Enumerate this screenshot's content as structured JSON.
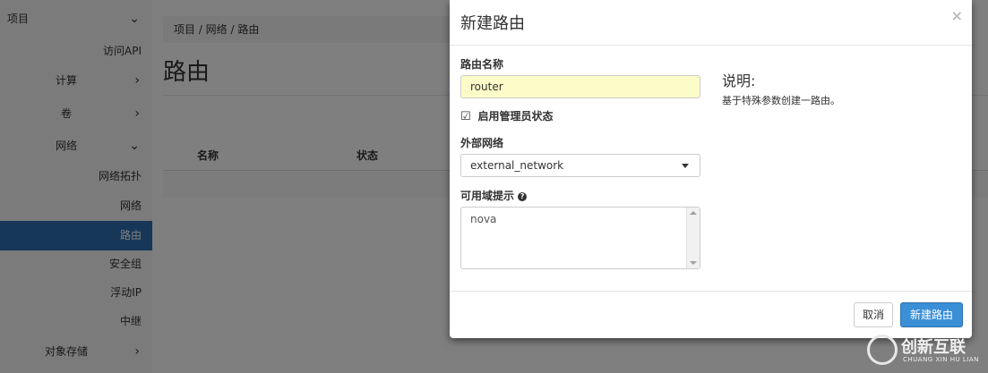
{
  "sidebar": {
    "items": [
      {
        "label": "项目",
        "chevron": "chevron-down"
      },
      {
        "label": "访问API"
      },
      {
        "label": "计算",
        "chevron": "chevron-right"
      },
      {
        "label": "卷",
        "chevron": "chevron-right"
      },
      {
        "label": "网络",
        "chevron": "chevron-down"
      },
      {
        "label": "网络拓扑"
      },
      {
        "label": "网络"
      },
      {
        "label": "路由",
        "active": true
      },
      {
        "label": "安全组"
      },
      {
        "label": "浮动IP"
      },
      {
        "label": "中继"
      },
      {
        "label": "对象存储",
        "chevron": "chevron-right"
      }
    ]
  },
  "breadcrumb": {
    "text": "项目 /  网络 /  路由"
  },
  "page": {
    "title": "路由"
  },
  "table": {
    "headers": [
      "名称",
      "状态"
    ]
  },
  "modal": {
    "title": "新建路由",
    "close": "×",
    "name_label": "路由名称",
    "name_value": "router",
    "admin_state_label": "启用管理员状态",
    "admin_state_checked": true,
    "external_network_label": "外部网络",
    "external_network_value": "external_network",
    "az_hint_label": "可用域提示",
    "az_hint_value": "nova",
    "description_title": "说明:",
    "description_text": "基于特殊参数创建一路由。",
    "cancel_label": "取消",
    "create_label": "新建路由"
  },
  "watermark": {
    "big": "创新互联",
    "small": "CHUANG XIN HU LIAN"
  },
  "colors": {
    "active": "#2d6fae",
    "primary_button": "#3a8fd6",
    "input_highlight": "#fcfcc8"
  }
}
